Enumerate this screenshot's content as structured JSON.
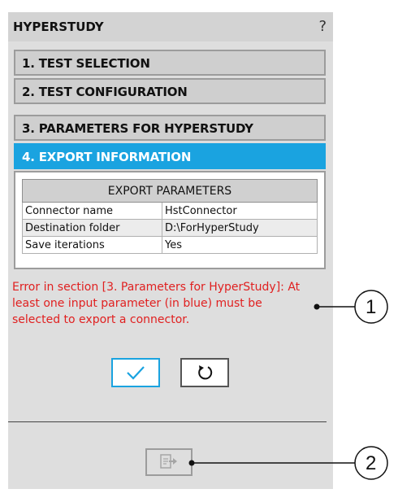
{
  "panel": {
    "title": "HYPERSTUDY",
    "help": "?"
  },
  "sections": [
    {
      "label": "1. TEST SELECTION"
    },
    {
      "label": "2. TEST CONFIGURATION"
    },
    {
      "label": "3. PARAMETERS FOR HYPERSTUDY"
    },
    {
      "label": "4. EXPORT INFORMATION"
    }
  ],
  "active_section_color": "#1aa3e0",
  "export_table": {
    "header": "EXPORT PARAMETERS",
    "rows": [
      {
        "key": "Connector name",
        "value": "HstConnector"
      },
      {
        "key": "Destination folder",
        "value": "D:\\ForHyperStudy"
      },
      {
        "key": "Save iterations",
        "value": "Yes"
      }
    ]
  },
  "error": {
    "text": "Error in section [3. Parameters for HyperStudy]: At least one input parameter (in blue) must be selected to export a connector.",
    "color": "#e02020"
  },
  "icons": {
    "confirm": "checkmark-icon",
    "reset": "reset-icon",
    "export": "export-connector-icon"
  },
  "callouts": [
    "1",
    "2"
  ]
}
